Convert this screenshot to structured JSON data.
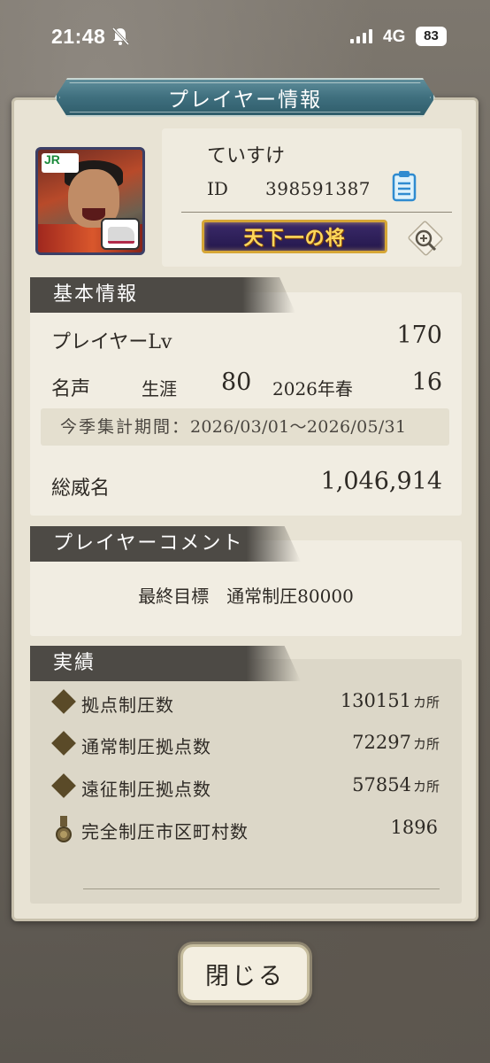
{
  "status_bar": {
    "time": "21:48",
    "network": "4G",
    "battery": "83"
  },
  "dialog": {
    "title": "プレイヤー情報",
    "close_label": "閉じる"
  },
  "profile": {
    "name": "ていすけ",
    "id_label": "ID",
    "id_value": "398591387",
    "title_plate": "天下一の将",
    "avatar_badge": "JR"
  },
  "basic_info": {
    "header": "基本情報",
    "level_label": "プレイヤーLv",
    "level_value": "170",
    "fame_label": "名声",
    "career_label": "生涯",
    "career_value": "80",
    "season_label": "2026年春",
    "season_value": "16",
    "period_label": "今季集計期間：",
    "period_value": "2026/03/01～2026/05/31",
    "total_label": "総威名",
    "total_value": "1,046,914"
  },
  "comment": {
    "header": "プレイヤーコメント",
    "text": "最終目標　通常制圧80000"
  },
  "achievements": {
    "header": "実績",
    "items": [
      {
        "label": "拠点制圧数",
        "value": "130151",
        "unit": "カ所",
        "icon": "diamond-icon"
      },
      {
        "label": "通常制圧拠点数",
        "value": "72297",
        "unit": "カ所",
        "icon": "diamond-icon"
      },
      {
        "label": "遠征制圧拠点数",
        "value": "57854",
        "unit": "カ所",
        "icon": "diamond-icon"
      },
      {
        "label": "完全制圧市区町村数",
        "value": "1896",
        "unit": "",
        "icon": "medal-icon"
      }
    ]
  }
}
